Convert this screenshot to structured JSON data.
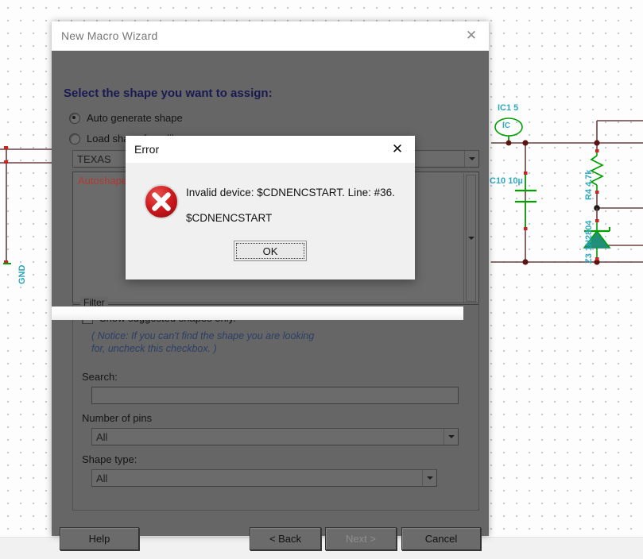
{
  "schematic": {
    "components": [
      {
        "ref": "IC1 5",
        "symbol": "IC"
      },
      {
        "ref": "C10 10µ"
      },
      {
        "ref": "R4 4.7k"
      },
      {
        "ref": "Z3 1N2804"
      },
      {
        "ref": "GND"
      }
    ],
    "labels": {
      "ic1": "IC1 5",
      "ic_symbol_text": "IC",
      "c10": "C10 10µ",
      "r4": "R4 4.7k",
      "z3": "Z3 1N2804",
      "gnd": "GND"
    },
    "colors": {
      "label": "#2fa8bd",
      "wire": "#6b4040",
      "component": "#00a000",
      "diode_fill": "#1f8f7a",
      "junction": "#5a1414"
    }
  },
  "wizard": {
    "title": "New Macro Wizard",
    "close_icon": "✕",
    "heading": "Select the shape you want to assign:",
    "options": [
      {
        "label": "Auto generate shape",
        "checked": true
      },
      {
        "label": "Load shape from library",
        "checked": false
      }
    ],
    "library_combo": {
      "value": "TEXAS",
      "icon": "chevron-down-icon"
    },
    "shape_list": {
      "items": [
        "Autoshape"
      ],
      "scroll_icon": "chevron-down-icon"
    },
    "filter": {
      "title": "Filter",
      "suggested_checkbox": {
        "label": "Show suggested shapes only.",
        "checked": false
      },
      "notice_line1": "( Notice: If you can't find the shape you are looking",
      "notice_line2": "for, uncheck this checkbox. )",
      "search_label": "Search:",
      "search_value": "",
      "search_placeholder": "",
      "pins_label": "Number of pins",
      "pins_value": "All",
      "shape_type_label": "Shape type:",
      "shape_type_value": "All"
    },
    "buttons": {
      "help": "Help",
      "back": "< Back",
      "next": "Next >",
      "next_disabled": true,
      "cancel": "Cancel"
    }
  },
  "error_dialog": {
    "title": "Error",
    "close_icon": "✕",
    "icon": "error-circle-x-icon",
    "message_line1": "Invalid device: $CDNENCSTART. Line: #36.",
    "message_line2": "$CDNENCSTART",
    "ok_label": "OK",
    "accent_color": "#c8161d"
  }
}
